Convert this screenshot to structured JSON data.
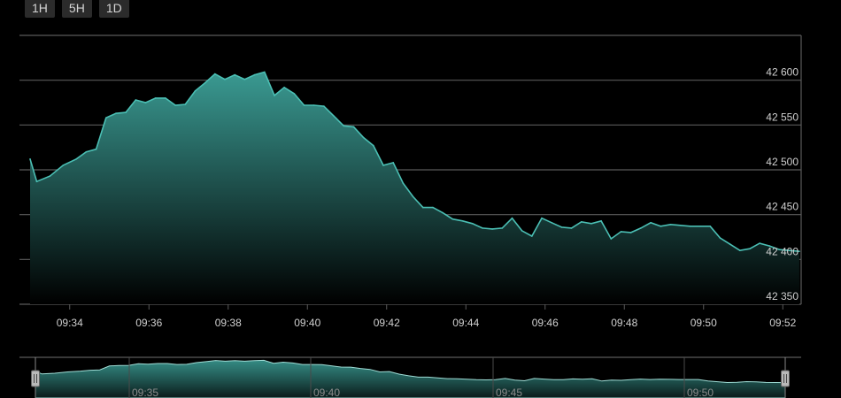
{
  "range_buttons": [
    "1H",
    "5H",
    "1D"
  ],
  "colors": {
    "background": "#000000",
    "area_line": "#4bbfb4",
    "area_fill_top": "#3a9a92",
    "grid": "#5a5a5a",
    "text": "#d0d0d0"
  },
  "chart_data": {
    "type": "area",
    "title": "",
    "xlabel": "",
    "ylabel": "",
    "xlim": [
      "09:33",
      "09:52"
    ],
    "ylim": [
      42350,
      42650
    ],
    "y_ticks": [
      42350,
      42400,
      42450,
      42500,
      42550,
      42600
    ],
    "y_tick_labels": [
      "42 350",
      "42 400",
      "42 450",
      "42 500",
      "42 550",
      "42 600"
    ],
    "x_ticks": [
      "09:34",
      "09:36",
      "09:38",
      "09:40",
      "09:42",
      "09:44",
      "09:46",
      "09:48",
      "09:50",
      "09:52"
    ],
    "grid": true,
    "series": [
      {
        "x": [
          "09:33:00",
          "09:33:10",
          "09:33:30",
          "09:33:50",
          "09:34:10",
          "09:34:25",
          "09:34:40",
          "09:34:55",
          "09:35:10",
          "09:35:25",
          "09:35:40",
          "09:35:55",
          "09:36:10",
          "09:36:25",
          "09:36:40",
          "09:36:55",
          "09:37:10",
          "09:37:25",
          "09:37:40",
          "09:37:55",
          "09:38:10",
          "09:38:25",
          "09:38:40",
          "09:38:55",
          "09:39:10",
          "09:39:25",
          "09:39:40",
          "09:39:55",
          "09:40:10",
          "09:40:25",
          "09:40:40",
          "09:40:55",
          "09:41:10",
          "09:41:25",
          "09:41:40",
          "09:41:55",
          "09:42:10",
          "09:42:25",
          "09:42:40",
          "09:42:55",
          "09:43:10",
          "09:43:25",
          "09:43:40",
          "09:43:55",
          "09:44:10",
          "09:44:25",
          "09:44:40",
          "09:44:55",
          "09:45:10",
          "09:45:25",
          "09:45:40",
          "09:45:55",
          "09:46:10",
          "09:46:25",
          "09:46:40",
          "09:46:55",
          "09:47:10",
          "09:47:25",
          "09:47:40",
          "09:47:55",
          "09:48:10",
          "09:48:25",
          "09:48:40",
          "09:48:55",
          "09:49:10",
          "09:49:25",
          "09:49:40",
          "09:49:55",
          "09:50:10",
          "09:50:25",
          "09:50:40",
          "09:50:55",
          "09:51:10",
          "09:51:25",
          "09:51:40",
          "09:51:55",
          "09:52:10",
          "09:52:25"
        ],
        "values": [
          42512,
          42487,
          42493,
          42505,
          42512,
          42520,
          42523,
          42558,
          42563,
          42564,
          42578,
          42575,
          42580,
          42580,
          42572,
          42573,
          42588,
          42597,
          42607,
          42601,
          42606,
          42601,
          42606,
          42609,
          42583,
          42592,
          42585,
          42572,
          42572,
          42571,
          42560,
          42549,
          42548,
          42536,
          42527,
          42505,
          42508,
          42485,
          42470,
          42458,
          42458,
          42452,
          42445,
          42443,
          42440,
          42435,
          42434,
          42435,
          42446,
          42432,
          42426,
          42446,
          42441,
          42436,
          42435,
          42442,
          42440,
          42443,
          42423,
          42431,
          42430,
          42435,
          42441,
          42437,
          42439,
          42438,
          42437,
          42437,
          42437,
          42424,
          42417,
          42410,
          42412,
          42418,
          42415,
          42411,
          42410,
          42409
        ]
      }
    ]
  },
  "navigator": {
    "labels": [
      "09:35",
      "09:40",
      "09:45",
      "09:50"
    ]
  }
}
